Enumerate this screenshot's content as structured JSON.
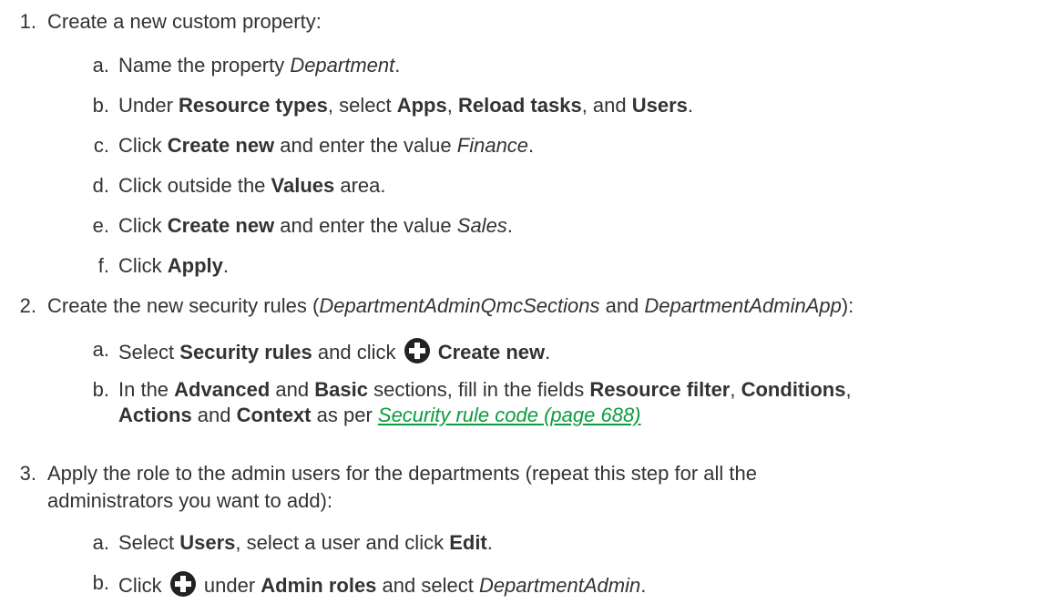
{
  "steps": [
    {
      "num": "1.",
      "text": "Create a new custom property:",
      "sub": [
        {
          "l": "a.",
          "p1": "Name the property ",
          "i1": "Department",
          "p2": "."
        },
        {
          "l": "b.",
          "p1": "Under ",
          "b1": "Resource types",
          "p2": ", select ",
          "b2": "Apps",
          "p3": ", ",
          "b3": "Reload tasks",
          "p4": ", and ",
          "b4": "Users",
          "p5": "."
        },
        {
          "l": "c.",
          "p1": "Click ",
          "b1": "Create new",
          "p2": " and enter the value ",
          "i1": "Finance",
          "p3": "."
        },
        {
          "l": "d.",
          "p1": "Click outside the ",
          "b1": "Values",
          "p2": " area."
        },
        {
          "l": "e.",
          "p1": "Click ",
          "b1": "Create new",
          "p2": " and enter the value ",
          "i1": "Sales",
          "p3": "."
        },
        {
          "l": "f.",
          "p1": "Click ",
          "b1": "Apply",
          "p2": "."
        }
      ]
    },
    {
      "num": "2.",
      "p1": "Create the new security rules (",
      "i1": "DepartmentAdminQmcSections",
      "p2": " and ",
      "i2": "DepartmentAdminApp",
      "p3": "):",
      "sub": [
        {
          "l": "a.",
          "p1": "Select ",
          "b1": "Security rules",
          "p2": " and click ",
          "b2": "Create new",
          "p3": "."
        },
        {
          "l": "b.",
          "p1": "In the ",
          "b1": "Advanced",
          "p2": " and ",
          "b2": "Basic",
          "p3": " sections, fill in the fields ",
          "b3": "Resource filter",
          "p4": ", ",
          "b4": "Conditions",
          "p5": ",",
          "b5": "Actions",
          "p6": " and ",
          "b6": "Context",
          "p7": " as per ",
          "link": "Security rule code (page 688)"
        }
      ]
    },
    {
      "num": "3.",
      "line1": "Apply the role to the admin users for the departments (repeat this step for all the",
      "line2": "administrators you want to add):",
      "sub": [
        {
          "l": "a.",
          "p1": "Select ",
          "b1": "Users",
          "p2": ", select a user and click ",
          "b2": "Edit",
          "p3": "."
        },
        {
          "l": "b.",
          "p1": "Click ",
          "p2": " under ",
          "b1": "Admin roles",
          "p3": " and select ",
          "i1": "DepartmentAdmin",
          "p4": "."
        }
      ]
    }
  ],
  "icons": {
    "plus": "plus-circle-icon"
  },
  "colors": {
    "text": "#333333",
    "link": "#0c9c3f",
    "icon": "#222222"
  }
}
